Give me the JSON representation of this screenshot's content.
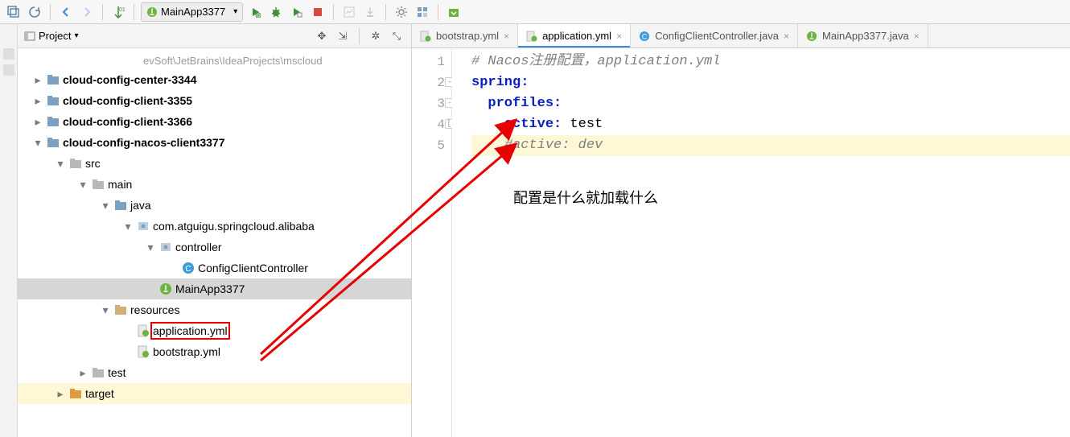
{
  "toolbar": {
    "run_config_label": "MainApp3377"
  },
  "project_panel": {
    "title": "Project",
    "root_path": "evSoft\\JetBrains\\IdeaProjects\\mscloud",
    "nodes": {
      "n0": "cloud-config-center-3344",
      "n1": "cloud-config-client-3355",
      "n2": "cloud-config-client-3366",
      "n3": "cloud-config-nacos-client3377",
      "n4": "src",
      "n5": "main",
      "n6": "java",
      "n7": "com.atguigu.springcloud.alibaba",
      "n8": "controller",
      "n9": "ConfigClientController",
      "n10": "MainApp3377",
      "n11": "resources",
      "n12": "application.yml",
      "n13": "bootstrap.yml",
      "n14": "test",
      "n15": "target"
    }
  },
  "editor_tabs": [
    {
      "label": "bootstrap.yml",
      "icon": "spring",
      "active": false
    },
    {
      "label": "application.yml",
      "icon": "spring",
      "active": true
    },
    {
      "label": "ConfigClientController.java",
      "icon": "class",
      "active": false
    },
    {
      "label": "MainApp3377.java",
      "icon": "spring-class",
      "active": false
    }
  ],
  "code": {
    "l1_comment": "# Nacos注册配置，application.yml",
    "l2_key": "spring",
    "l3_key": "profiles",
    "l4_key": "active",
    "l4_val": "test",
    "l5_comment": "#active: dev"
  },
  "annotation_text": "配置是什么就加载什么",
  "colors": {
    "accent": "#3b86d6",
    "arrow": "#e60000",
    "comment": "#808080",
    "key": "#0a1fbf"
  }
}
